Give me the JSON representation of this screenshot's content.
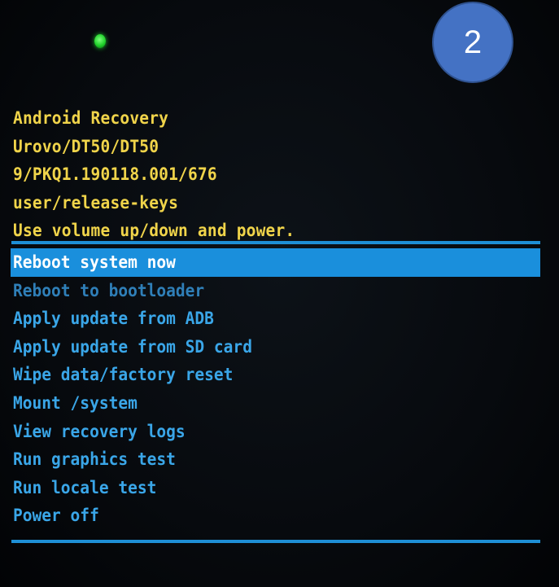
{
  "badge": {
    "number": "2"
  },
  "header": {
    "lines": [
      "Android Recovery",
      "Urovo/DT50/DT50",
      "9/PKQ1.190118.001/676",
      "user/release-keys",
      "Use volume up/down and power."
    ]
  },
  "menu": {
    "selected_index": 0,
    "items": [
      {
        "label": "Reboot system now"
      },
      {
        "label": "Reboot to bootloader"
      },
      {
        "label": "Apply update from ADB"
      },
      {
        "label": "Apply update from SD card"
      },
      {
        "label": "Wipe data/factory reset"
      },
      {
        "label": "Mount /system"
      },
      {
        "label": "View recovery logs"
      },
      {
        "label": "Run graphics test"
      },
      {
        "label": "Run locale test"
      },
      {
        "label": "Power off"
      }
    ]
  },
  "colors": {
    "header_text": "#f0d44a",
    "menu_text": "#3aa6e8",
    "selection_bg": "#1a8fdc",
    "divider": "#1e8fd6",
    "badge_bg": "#4472c4",
    "led": "#1fd12a"
  }
}
